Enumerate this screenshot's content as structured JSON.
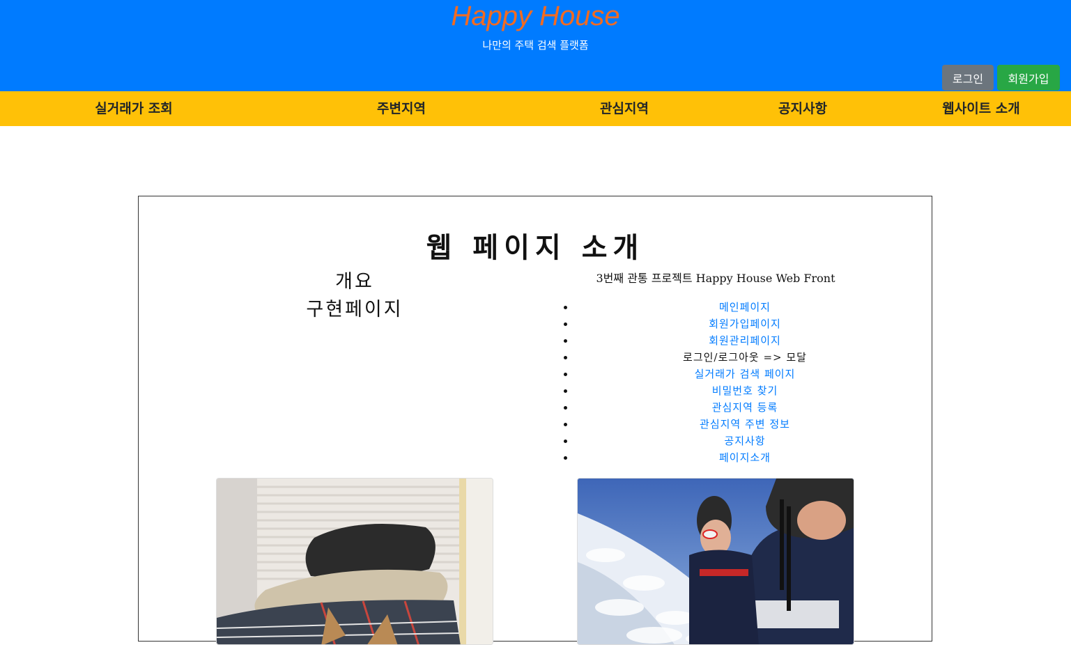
{
  "header": {
    "title": "Happy House",
    "subtitle": "나만의 주택 검색 플랫폼",
    "login_label": "로그인",
    "signup_label": "회원가입"
  },
  "nav": {
    "items": [
      {
        "label": "실거래가 조회"
      },
      {
        "label": "주변지역"
      },
      {
        "label": "관심지역"
      },
      {
        "label": "공지사항"
      },
      {
        "label": "웹사이트 소개"
      }
    ]
  },
  "main": {
    "heading": "웹 페이지 소개",
    "overview_label": "개요",
    "implemented_label": "구현페이지",
    "project_title": "3번째 관통 프로젝트 Happy House Web Front",
    "pages": [
      {
        "label": "메인페이지",
        "link": true
      },
      {
        "label": "회원가입페이지",
        "link": true
      },
      {
        "label": "회원관리페이지",
        "link": true
      },
      {
        "label": "로그인/로그아웃 => 모달",
        "link": false
      },
      {
        "label": "실거래가 검색 페이지",
        "link": true
      },
      {
        "label": "비밀번호 찾기",
        "link": true
      },
      {
        "label": "관심지역 등록",
        "link": true
      },
      {
        "label": "관심지역 주변 정보",
        "link": true
      },
      {
        "label": "공지사항",
        "link": true
      },
      {
        "label": "페이지소개",
        "link": true
      }
    ]
  },
  "colors": {
    "header_bg": "#007bff",
    "title": "#f26b21",
    "nav_bg": "#ffc107",
    "login_btn": "#6c757d",
    "signup_btn": "#28a745",
    "link": "#007bff"
  }
}
